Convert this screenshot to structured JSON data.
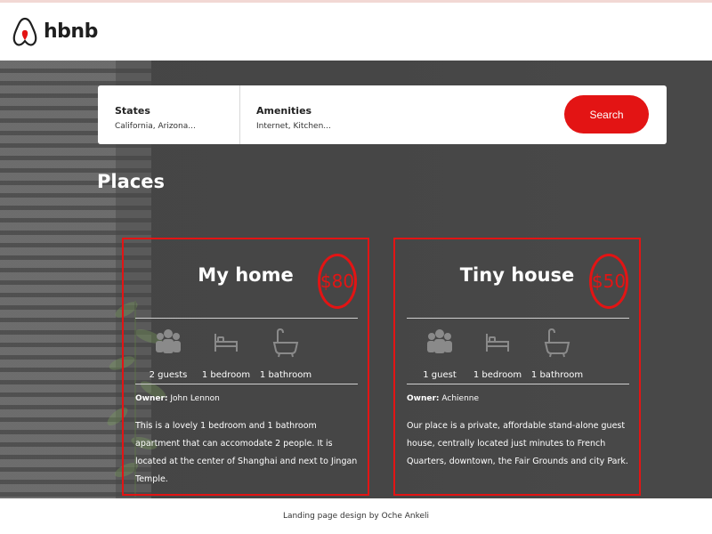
{
  "header": {
    "logo_text": "hbnb",
    "logo_icon": "airbnb-logo-icon"
  },
  "search": {
    "states": {
      "title": "States",
      "value": "California, Arizona..."
    },
    "amenities": {
      "title": "Amenities",
      "value": "Internet, Kitchen..."
    },
    "button_label": "Search",
    "accent_color": "#e31414"
  },
  "places": {
    "title": "Places",
    "items": [
      {
        "name": "My home",
        "price": "$80",
        "guests": "2 guests",
        "bedrooms": "1 bedroom",
        "bathrooms": "1 bathroom",
        "owner_label": "Owner:",
        "owner_name": "John Lennon",
        "description": "This is a lovely 1 bedroom and 1 bathroom apartment that can accomodate 2 people. It is located at the center of Shanghai and next to Jingan Temple."
      },
      {
        "name": "Tiny house",
        "price": "$50",
        "guests": "1 guest",
        "bedrooms": "1 bedroom",
        "bathrooms": "1 bathroom",
        "owner_label": "Owner:",
        "owner_name": "Achienne",
        "description": "Our place is a private, affordable stand-alone guest house, centrally located just minutes to French Quarters, downtown, the Fair Grounds and city Park."
      }
    ]
  },
  "footer": {
    "text": "Landing page design by Oche Ankeli"
  }
}
